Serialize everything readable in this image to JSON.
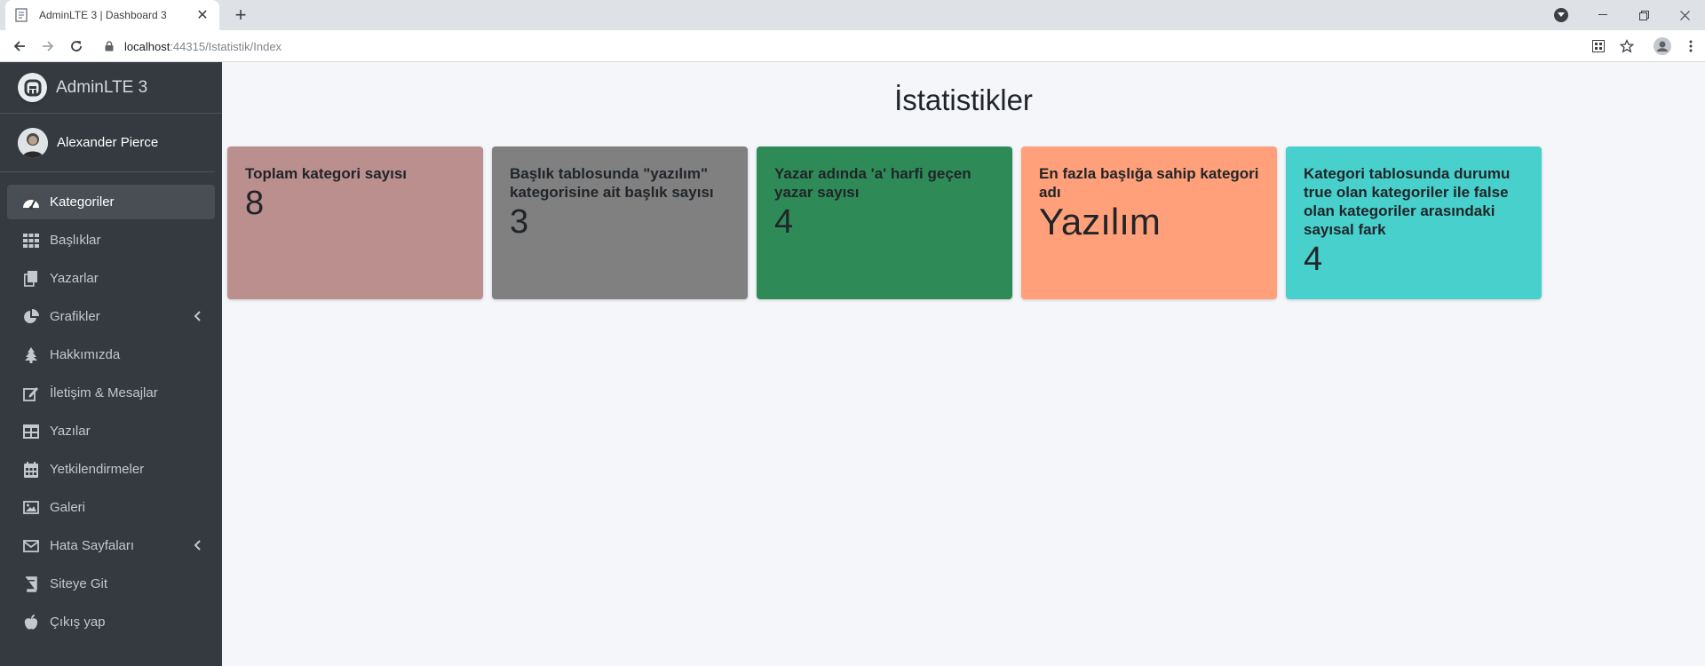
{
  "browser": {
    "tab_title": "AdminLTE 3 | Dashboard 3",
    "tab_close": "✕",
    "new_tab": "+",
    "url_host": "localhost",
    "url_path": ":44315/Istatistik/Index"
  },
  "sidebar": {
    "brand": "AdminLTE 3",
    "user_name": "Alexander Pierce",
    "items": [
      {
        "label": "Kategoriler",
        "icon": "tachometer-icon",
        "active": true
      },
      {
        "label": "Başlıklar",
        "icon": "grid-icon"
      },
      {
        "label": "Yazarlar",
        "icon": "copy-icon"
      },
      {
        "label": "Grafikler",
        "icon": "pie-chart-icon",
        "arrow": true
      },
      {
        "label": "Hakkımızda",
        "icon": "tree-icon"
      },
      {
        "label": "İletişim & Mesajlar",
        "icon": "edit-icon"
      },
      {
        "label": "Yazılar",
        "icon": "table-icon"
      },
      {
        "label": "Yetkilendirmeler",
        "icon": "calendar-icon"
      },
      {
        "label": "Galeri",
        "icon": "image-icon"
      },
      {
        "label": "Hata Sayfaları",
        "icon": "envelope-icon",
        "arrow": true
      },
      {
        "label": "Siteye Git",
        "icon": "book-icon"
      },
      {
        "label": "Çıkış yap",
        "icon": "apple-icon"
      }
    ]
  },
  "main": {
    "title": "İstatistikler",
    "boxes": [
      {
        "label": "Toplam kategori sayısı",
        "value": "8",
        "color": "#bc8f8f"
      },
      {
        "label": "Başlık tablosunda \"yazılım\" kategorisine ait başlık sayısı",
        "value": "3",
        "color": "#808080"
      },
      {
        "label": "Yazar adında 'a' harfi geçen yazar sayısı",
        "value": "4",
        "color": "#2e8b57"
      },
      {
        "label": "En fazla başlığa sahip kategori adı",
        "value": "Yazılım",
        "color": "#ffa07a"
      },
      {
        "label": "Kategori tablosunda durumu true olan kategoriler ile false olan kategoriler arasındaki sayısal fark",
        "value": "4",
        "color": "#48d1cc"
      }
    ]
  }
}
